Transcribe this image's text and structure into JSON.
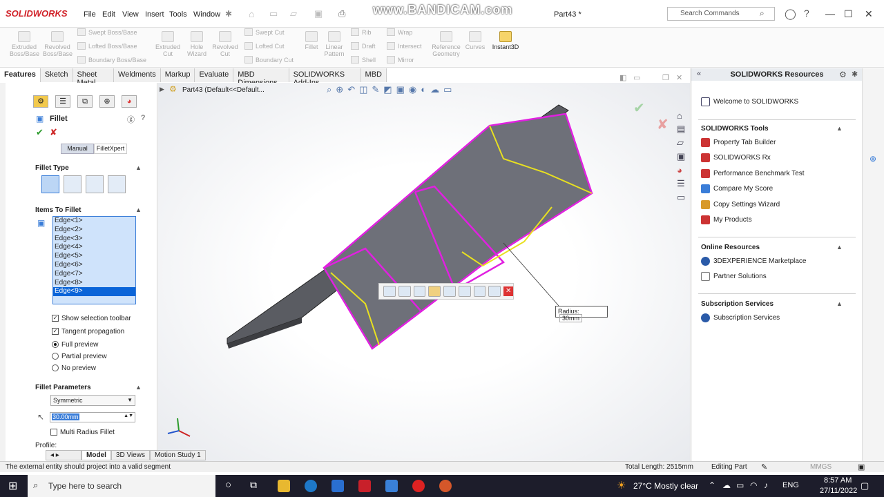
{
  "app": {
    "logo": "SOLIDWORKS",
    "menus": [
      "File",
      "Edit",
      "View",
      "Insert",
      "Tools",
      "Window"
    ],
    "watermark": "www.BANDICAM.com",
    "doc_title": "Part43 *",
    "search_placeholder": "Search Commands"
  },
  "ribbon": {
    "big_buttons": [
      "Extruded Boss/Base",
      "Revolved Boss/Base"
    ],
    "boss_group": [
      "Swept Boss/Base",
      "Lofted Boss/Base",
      "Boundary Boss/Base"
    ],
    "cut_buttons": [
      "Extruded Cut",
      "Hole Wizard",
      "Revolved Cut"
    ],
    "cut_group": [
      "Swept Cut",
      "Lofted Cut",
      "Boundary Cut"
    ],
    "fillet_buttons": [
      "Fillet",
      "Linear Pattern"
    ],
    "feature_group1": [
      "Rib",
      "Draft",
      "Shell"
    ],
    "feature_group2": [
      "Wrap",
      "Intersect",
      "Mirror"
    ],
    "ref_buttons": [
      "Reference Geometry",
      "Curves"
    ],
    "instant3d": "Instant3D"
  },
  "tabs": [
    "Features",
    "Sketch",
    "Sheet Metal",
    "Weldments",
    "Markup",
    "Evaluate",
    "MBD Dimensions",
    "SOLIDWORKS Add-Ins",
    "MBD"
  ],
  "feature_tree_header": "Part43  (Default<<Default...",
  "property_manager": {
    "title": "Fillet",
    "mode_tabs": [
      "Manual",
      "FilletXpert"
    ],
    "fillet_type_label": "Fillet Type",
    "items_label": "Items To Fillet",
    "edges": [
      "Edge<1>",
      "Edge<2>",
      "Edge<3>",
      "Edge<4>",
      "Edge<5>",
      "Edge<6>",
      "Edge<7>",
      "Edge<8>",
      "Edge<9>"
    ],
    "selected_edge": "Edge<9>",
    "show_selection_toolbar": "Show selection toolbar",
    "tangent_propagation": "Tangent propagation",
    "full_preview": "Full preview",
    "partial_preview": "Partial preview",
    "no_preview": "No preview",
    "params_label": "Fillet Parameters",
    "symmetry": "Symmetric",
    "radius_value": "30.00mm",
    "multi_radius": "Multi Radius Fillet",
    "profile_label": "Profile:"
  },
  "viewport": {
    "radius_label": "Radius:",
    "radius_value": "30mm"
  },
  "resources": {
    "title": "SOLIDWORKS Resources",
    "welcome": "Welcome to SOLIDWORKS",
    "tools_header": "SOLIDWORKS Tools",
    "tools": [
      "Property Tab Builder",
      "SOLIDWORKS Rx",
      "Performance Benchmark Test",
      "Compare My Score",
      "Copy Settings Wizard",
      "My Products"
    ],
    "online_header": "Online Resources",
    "online": [
      "3DEXPERIENCE Marketplace",
      "Partner Solutions"
    ],
    "subs_header": "Subscription Services",
    "subs": [
      "Subscription Services"
    ]
  },
  "bottom_tabs": [
    "Model",
    "3D Views",
    "Motion Study 1"
  ],
  "status": {
    "message": "The external entity should project into a valid segment",
    "total_length": "Total Length: 2515mm",
    "mode": "Editing Part",
    "units": "MMGS"
  },
  "taskbar": {
    "search_placeholder": "Type here to search",
    "weather": "27°C  Mostly clear",
    "lang": "ENG",
    "time": "8:57 AM",
    "date": "27/11/2022"
  }
}
